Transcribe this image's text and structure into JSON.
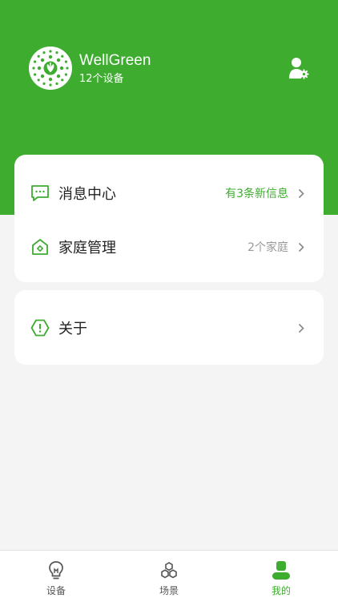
{
  "colors": {
    "accent": "#3dac2f",
    "background": "#f4f4f4",
    "card": "#ffffff",
    "muted": "#999999"
  },
  "header": {
    "user_name": "WellGreen",
    "device_count": "12个设备",
    "avatar_icon": "plant-logo-icon",
    "settings_icon": "user-settings-icon"
  },
  "menu": {
    "items": [
      {
        "label": "消息中心",
        "value": "有3条新信息",
        "icon": "message-icon"
      },
      {
        "label": "家庭管理",
        "value": "2个家庭",
        "icon": "home-icon"
      },
      {
        "label": "关于",
        "value": "",
        "icon": "info-icon"
      }
    ]
  },
  "tabs": [
    {
      "label": "设备",
      "icon": "bulb-icon",
      "active": false
    },
    {
      "label": "场景",
      "icon": "scene-icon",
      "active": false
    },
    {
      "label": "我的",
      "icon": "profile-icon",
      "active": true
    }
  ]
}
